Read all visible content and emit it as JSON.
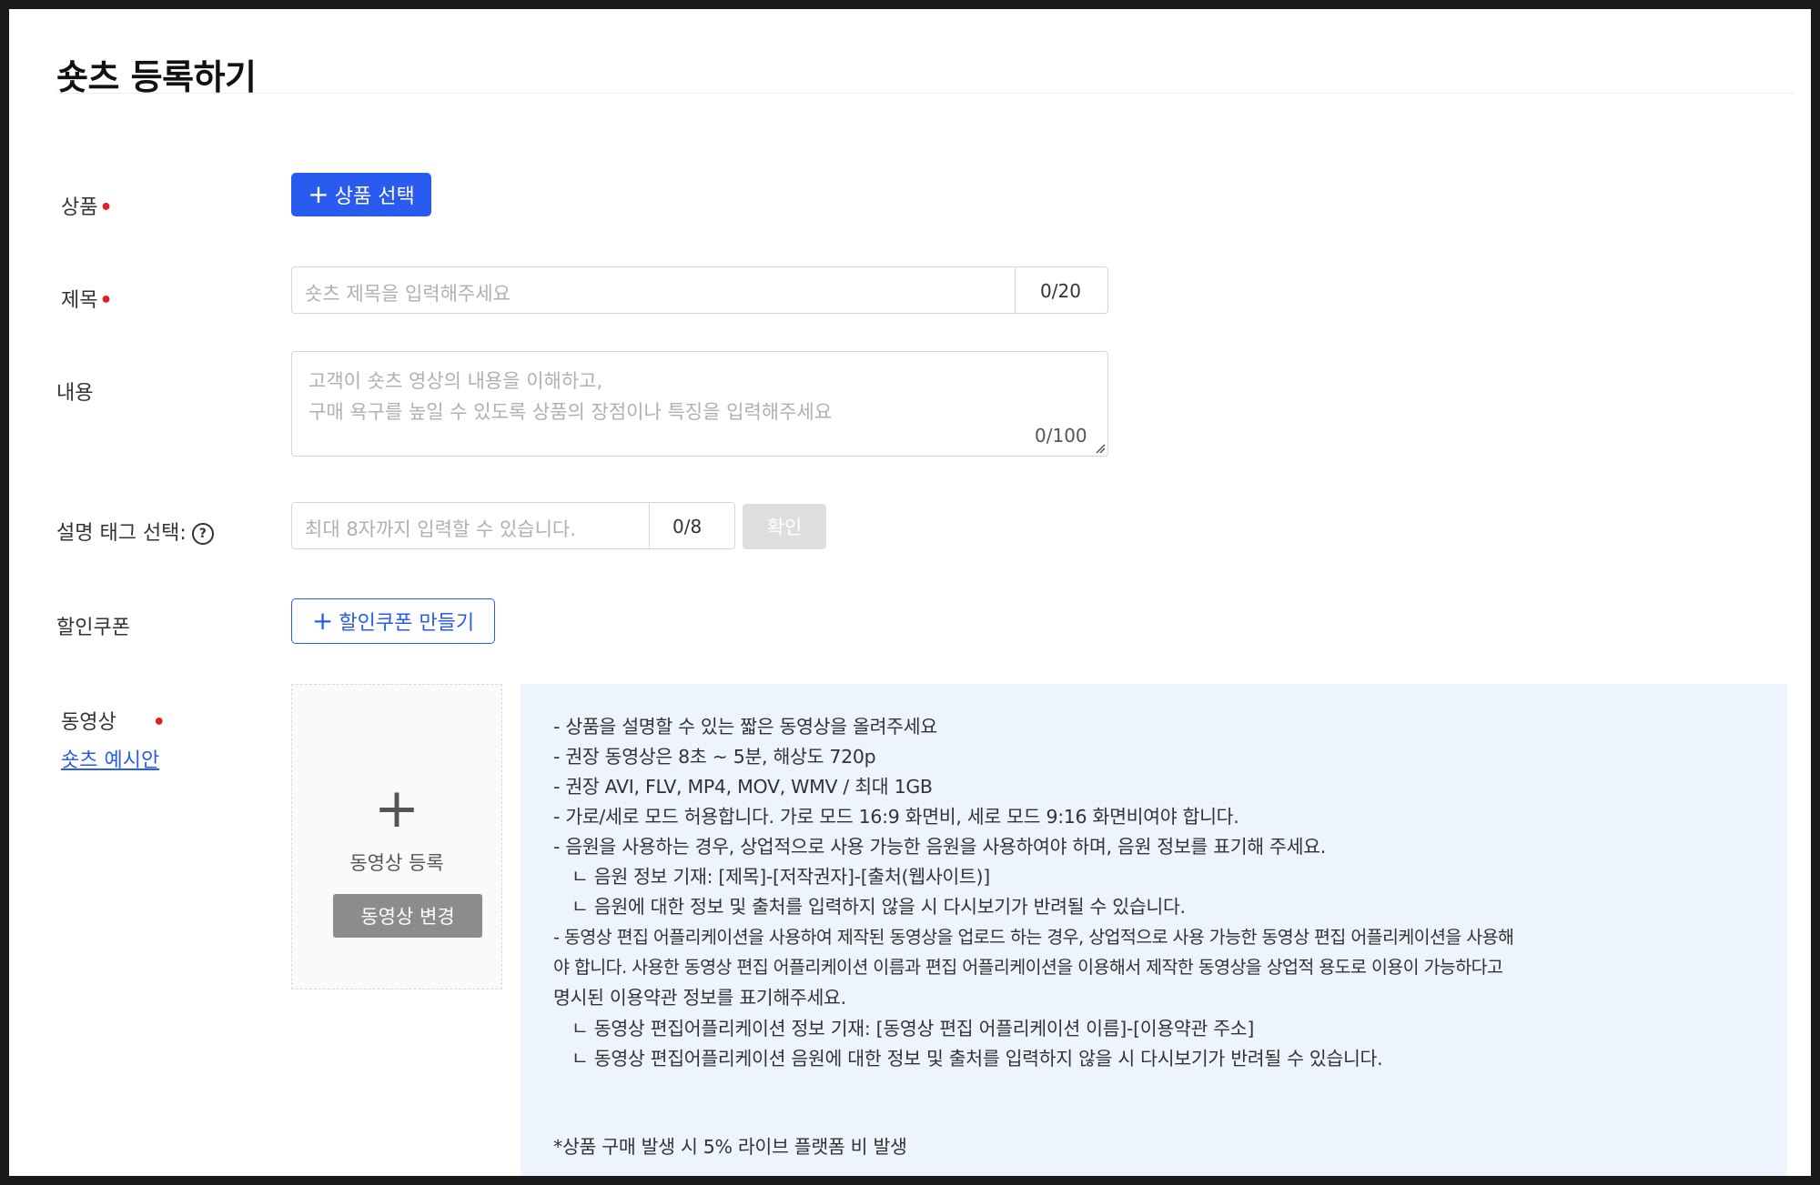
{
  "page": {
    "title": "숏츠 등록하기"
  },
  "fields": {
    "product": {
      "label": "상품",
      "required_mark": "•",
      "button_icon": "+",
      "button_label": "상품 선택"
    },
    "title": {
      "label": "제목",
      "required_mark": "•",
      "placeholder": "숏츠 제목을 입력해주세요",
      "counter": "0/20"
    },
    "content": {
      "label": "내용",
      "placeholder_line1": "고객이 숏츠 영상의 내용을 이해하고,",
      "placeholder_line2": "구매 욕구를 높일 수 있도록 상품의 장점이나 특징을 입력해주세요",
      "counter": "0/100"
    },
    "tags": {
      "label": "설명 태그 선택:",
      "help_icon": "?",
      "placeholder": "최대 8자까지 입력할 수 있습니다.",
      "counter": "0/8",
      "confirm_label": "확인"
    },
    "coupon": {
      "label": "할인쿠폰",
      "button_icon": "+",
      "button_label": "할인쿠폰 만들기"
    },
    "video": {
      "label": "동영상",
      "required_mark": "•",
      "sample_link": "숏츠 예시안",
      "upload_icon": "+",
      "upload_label": "동영상 등록",
      "change_label": "동영상 변경"
    }
  },
  "info": {
    "lines": [
      "- 상품을 설명할 수 있는 짧은 동영상을 올려주세요",
      "- 권장 동영상은 8초 ~ 5분, 해상도 720p",
      "- 권장 AVI, FLV, MP4, MOV, WMV / 최대 1GB",
      "- 가로/세로 모드 허용합니다. 가로 모드 16:9 화면비, 세로 모드 9:16 화면비여야 합니다.",
      "- 음원을 사용하는 경우, 상업적으로 사용 가능한 음원을 사용하여야 하며, 음원 정보를 표기해 주세요.",
      "ㄴ 음원 정보 기재: [제목]-[저작권자]-[출처(웹사이트)]",
      "ㄴ 음원에 대한 정보 및 출처를 입력하지 않을 시 다시보기가 반려될 수 있습니다.",
      "- 동영상 편집 어플리케이션을 사용하여 제작된 동영상을 업로드 하는 경우, 상업적으로 사용 가능한 동영상 편집 어플리케이션을 사용해",
      "야 합니다. 사용한 동영상 편집 어플리케이션 이름과 편집 어플리케이션을 이용해서 제작한 동영상을 상업적 용도로 이용이 가능하다고",
      "명시된 이용약관 정보를 표기해주세요.",
      "ㄴ 동영상 편집어플리케이션 정보 기재: [동영상 편집 어플리케이션 이름]-[이용약관 주소]",
      "ㄴ 동영상 편집어플리케이션 음원에 대한 정보 및 출처를 입력하지 않을 시 다시보기가 반려될 수 있습니다."
    ],
    "footnote": "*상품 구매 발생 시 5% 라이브 플랫폼 비 발생"
  }
}
